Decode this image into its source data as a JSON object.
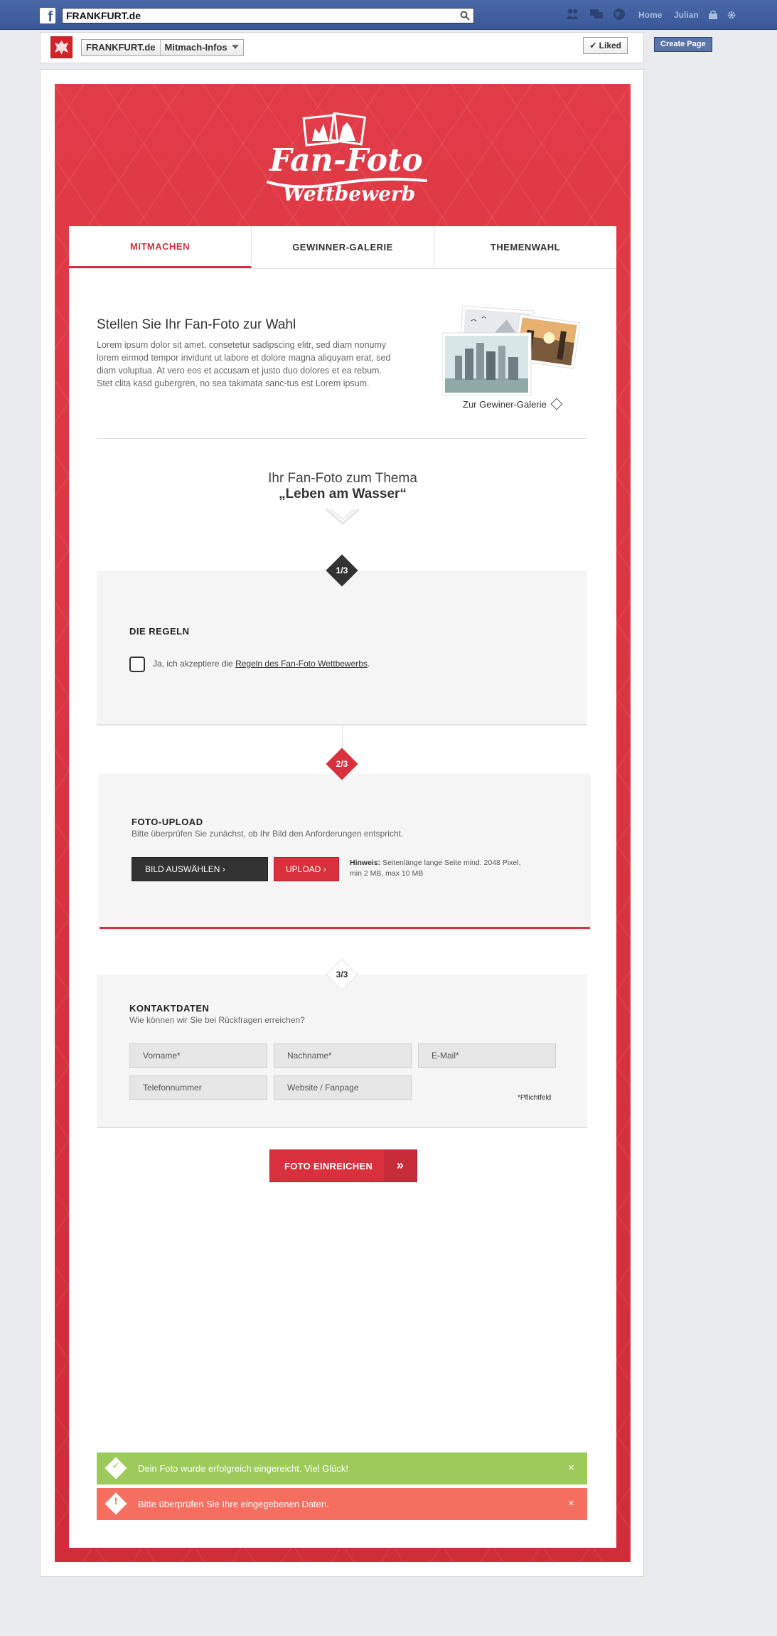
{
  "fb": {
    "search_value": "FRANKFURT.de",
    "nav": [
      "Home",
      "Julian"
    ]
  },
  "page": {
    "name": "FRANKFURT.de",
    "menu": "Mitmach-Infos",
    "liked_label": "✔ Liked",
    "create_page": "Create Page"
  },
  "hero": {
    "logo_line1": "Fan-Foto",
    "logo_line2": "Wettbewerb"
  },
  "tabs": [
    {
      "label": "MITMACHEN",
      "active": true
    },
    {
      "label": "GEWINNER-GALERIE",
      "active": false
    },
    {
      "label": "THEMENWAHL",
      "active": false
    }
  ],
  "intro": {
    "title": "Stellen Sie Ihr Fan-Foto zur Wahl",
    "body": "Lorem ipsum dolor sit amet, consetetur sadipscing elitr, sed diam nonumy lorem eirmod tempor invidunt ut labore et dolore magna aliquyam erat, sed diam voluptua. At vero eos et accusam et justo duo dolores et ea rebum. Stet clita kasd gubergren, no sea takimata sanc-tus est Lorem ipsum.",
    "gallery_link": "Zur Gewiner-Galerie"
  },
  "theme": {
    "line1": "Ihr Fan-Foto zum Thema",
    "line2": "„Leben am Wasser“"
  },
  "step1": {
    "badge": "1/3",
    "title": "DIE REGELN",
    "accept_prefix": "Ja, ich akzeptiere die ",
    "accept_link": "Regeln des Fan-Foto Wettbewerbs",
    "accept_suffix": "."
  },
  "step2": {
    "badge": "2/3",
    "title": "FOTO-UPLOAD",
    "subtitle": "Bitte überprüfen Sie zunächst, ob Ihr Bild den Anforderungen entspricht.",
    "choose_label": "BILD AUSWÄHLEN ›",
    "upload_label": "UPLOAD ›",
    "hint_label": "Hinweis:",
    "hint_text": " Seitenlänge lange Seite mind. 2048 Pixel, min 2 MB, max 10 MB"
  },
  "step3": {
    "badge": "3/3",
    "title": "KONTAKTDATEN",
    "subtitle": "Wie können wir Sie bei Rückfragen erreichen?",
    "fields": [
      "Vorname*",
      "Nachname*",
      "E-Mail*",
      "Telefonnummer",
      "Website / Fanpage"
    ],
    "required_note": "*Pflichtfeld"
  },
  "submit": {
    "label": "FOTO EINREICHEN",
    "arrow": "»"
  },
  "alerts": {
    "success": "Dein Foto wurde erfolgreich eingereicht. Viel Glück!",
    "error": "Bitte überprüfen Sie Ihre eingegebenen Daten.",
    "close": "×"
  },
  "colors": {
    "fb_blue": "#3b5998",
    "brand_red": "#d9303e",
    "success_green": "#9ccb5c",
    "error_coral": "#f46f5f"
  }
}
